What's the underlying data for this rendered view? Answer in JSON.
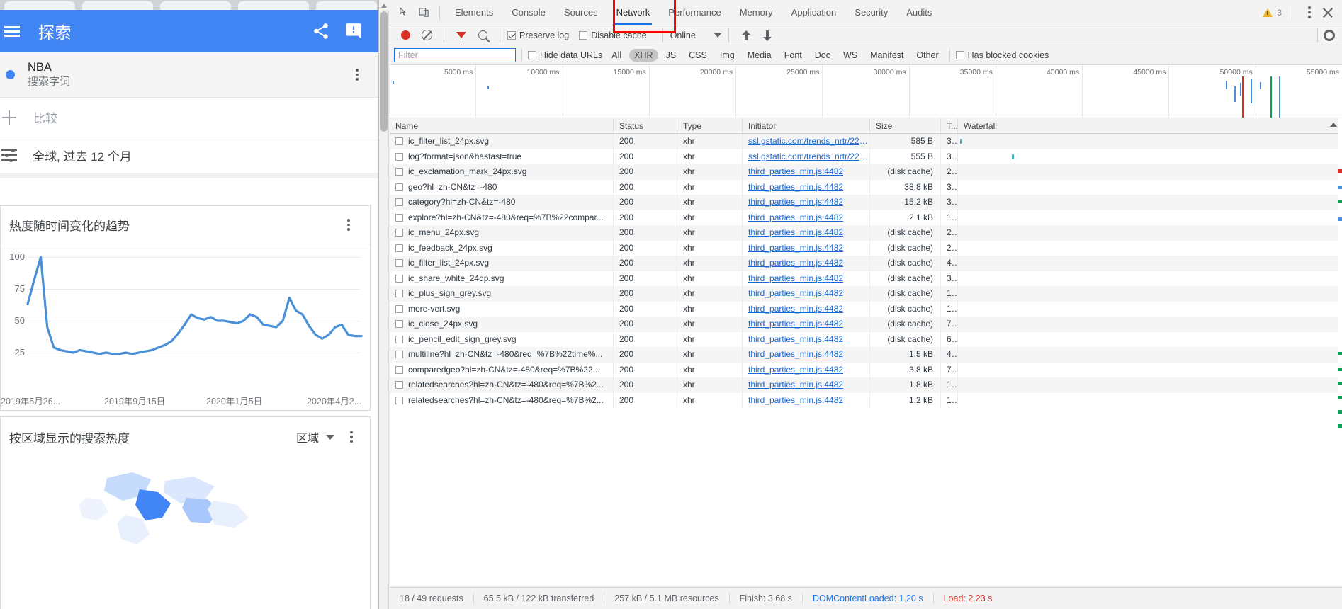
{
  "trends": {
    "app_title": "探索",
    "menu_icon": "hamburger-icon",
    "share_icon": "share-icon",
    "feedback_icon": "feedback-icon",
    "term": {
      "name": "NBA",
      "subtitle": "搜索字词"
    },
    "compare_label": "比较",
    "scope_label": "全球, 过去 12 个月",
    "trend_card": {
      "title": "热度随时间变化的趋势"
    },
    "region_card": {
      "title": "按区域显示的搜索热度",
      "select_value": "区域"
    }
  },
  "chart_data": {
    "type": "line",
    "title": "热度随时间变化的趋势",
    "xlabel": "",
    "ylabel": "",
    "ylim": [
      0,
      100
    ],
    "yticks": [
      100,
      75,
      50,
      25
    ],
    "grid": true,
    "legend": "none",
    "line_color": "#4a90d9",
    "xtick_labels": [
      "2019年5月26...",
      "2019年9月15日",
      "2020年1月5日",
      "2020年4月2..."
    ],
    "x": [
      0,
      1,
      2,
      3,
      4,
      5,
      6,
      7,
      8,
      9,
      10,
      11,
      12,
      13,
      14,
      15,
      16,
      17,
      18,
      19,
      20,
      21,
      22,
      23,
      24,
      25,
      26,
      27,
      28,
      29,
      30,
      31,
      32,
      33,
      34,
      35,
      36,
      37,
      38,
      39,
      40,
      41,
      42,
      43,
      44,
      45,
      46,
      47,
      48,
      49,
      50,
      51
    ],
    "values": [
      63,
      82,
      100,
      45,
      29,
      27,
      26,
      25,
      27,
      26,
      25,
      24,
      25,
      24,
      24,
      25,
      24,
      25,
      26,
      27,
      29,
      31,
      34,
      40,
      47,
      55,
      52,
      51,
      53,
      50,
      50,
      49,
      48,
      50,
      55,
      53,
      47,
      46,
      45,
      50,
      68,
      58,
      55,
      46,
      39,
      36,
      39,
      45,
      47,
      39,
      38,
      38
    ]
  },
  "devtools": {
    "tools": {
      "inspect_icon": "cursor-inspect-icon",
      "device_icon": "device-toolbar-icon"
    },
    "tabs": [
      {
        "label": "Elements",
        "active": false
      },
      {
        "label": "Console",
        "active": false
      },
      {
        "label": "Sources",
        "active": false
      },
      {
        "label": "Network",
        "active": true
      },
      {
        "label": "Performance",
        "active": false
      },
      {
        "label": "Memory",
        "active": false
      },
      {
        "label": "Application",
        "active": false
      },
      {
        "label": "Security",
        "active": false
      },
      {
        "label": "Audits",
        "active": false
      }
    ],
    "warning_count": "3",
    "more_icon": "more-vertical-icon",
    "close_icon": "close-icon",
    "toolbar": {
      "record_icon": "record-stop-icon",
      "clear_icon": "clear-icon",
      "filter_icon": "filter-icon",
      "search_icon": "search-icon",
      "preserve_log": "Preserve log",
      "preserve_log_checked": true,
      "disable_cache": "Disable cache",
      "disable_cache_checked": false,
      "throttle_value": "Online",
      "import_icon": "import-har-icon",
      "export_icon": "export-har-icon",
      "settings_icon": "gear-icon"
    },
    "filterbar": {
      "filter_placeholder": "Filter",
      "filter_value": "",
      "hide_data_urls": "Hide data URLs",
      "hide_data_urls_checked": false,
      "types": [
        "All",
        "XHR",
        "JS",
        "CSS",
        "Img",
        "Media",
        "Font",
        "Doc",
        "WS",
        "Manifest",
        "Other"
      ],
      "active_type": "XHR",
      "has_blocked_cookies": "Has blocked cookies",
      "has_blocked_cookies_checked": false
    },
    "overview_labels": [
      "5000 ms",
      "10000 ms",
      "15000 ms",
      "20000 ms",
      "25000 ms",
      "30000 ms",
      "35000 ms",
      "40000 ms",
      "45000 ms",
      "50000 ms",
      "55000 ms"
    ],
    "columns": [
      "Name",
      "Status",
      "Type",
      "Initiator",
      "Size",
      "T...",
      "Waterfall"
    ],
    "rows": [
      {
        "name": "ic_filter_list_24px.svg",
        "status": "200",
        "type": "xhr",
        "initiator": "ssl.gstatic.com/trends_nrtr/221...",
        "size": "585 B",
        "time": "3...",
        "wf_left": 0.5,
        "wf_width": 0.6
      },
      {
        "name": "log?format=json&hasfast=true",
        "status": "200",
        "type": "xhr",
        "initiator": "ssl.gstatic.com/trends_nrtr/221...",
        "size": "555 B",
        "time": "3...",
        "wf_left": 14,
        "wf_width": 0.6
      },
      {
        "name": "ic_exclamation_mark_24px.svg",
        "status": "200",
        "type": "xhr",
        "initiator": "third_parties_min.js:4482",
        "size": "(disk cache)",
        "time": "2...",
        "wf_left": 0,
        "wf_width": 0
      },
      {
        "name": "geo?hl=zh-CN&tz=-480",
        "status": "200",
        "type": "xhr",
        "initiator": "third_parties_min.js:4482",
        "size": "38.8 kB",
        "time": "3...",
        "wf_left": 0,
        "wf_width": 0
      },
      {
        "name": "category?hl=zh-CN&tz=-480",
        "status": "200",
        "type": "xhr",
        "initiator": "third_parties_min.js:4482",
        "size": "15.2 kB",
        "time": "3...",
        "wf_left": 0,
        "wf_width": 0
      },
      {
        "name": "explore?hl=zh-CN&tz=-480&req=%7B%22compar...",
        "status": "200",
        "type": "xhr",
        "initiator": "third_parties_min.js:4482",
        "size": "2.1 kB",
        "time": "1...",
        "wf_left": 0,
        "wf_width": 0
      },
      {
        "name": "ic_menu_24px.svg",
        "status": "200",
        "type": "xhr",
        "initiator": "third_parties_min.js:4482",
        "size": "(disk cache)",
        "time": "2...",
        "wf_left": 0,
        "wf_width": 0
      },
      {
        "name": "ic_feedback_24px.svg",
        "status": "200",
        "type": "xhr",
        "initiator": "third_parties_min.js:4482",
        "size": "(disk cache)",
        "time": "2...",
        "wf_left": 0,
        "wf_width": 0
      },
      {
        "name": "ic_filter_list_24px.svg",
        "status": "200",
        "type": "xhr",
        "initiator": "third_parties_min.js:4482",
        "size": "(disk cache)",
        "time": "4...",
        "wf_left": 0,
        "wf_width": 0
      },
      {
        "name": "ic_share_white_24dp.svg",
        "status": "200",
        "type": "xhr",
        "initiator": "third_parties_min.js:4482",
        "size": "(disk cache)",
        "time": "3...",
        "wf_left": 0,
        "wf_width": 0
      },
      {
        "name": "ic_plus_sign_grey.svg",
        "status": "200",
        "type": "xhr",
        "initiator": "third_parties_min.js:4482",
        "size": "(disk cache)",
        "time": "1...",
        "wf_left": 0,
        "wf_width": 0
      },
      {
        "name": "more-vert.svg",
        "status": "200",
        "type": "xhr",
        "initiator": "third_parties_min.js:4482",
        "size": "(disk cache)",
        "time": "1...",
        "wf_left": 0,
        "wf_width": 0
      },
      {
        "name": "ic_close_24px.svg",
        "status": "200",
        "type": "xhr",
        "initiator": "third_parties_min.js:4482",
        "size": "(disk cache)",
        "time": "7...",
        "wf_left": 0,
        "wf_width": 0
      },
      {
        "name": "ic_pencil_edit_sign_grey.svg",
        "status": "200",
        "type": "xhr",
        "initiator": "third_parties_min.js:4482",
        "size": "(disk cache)",
        "time": "6...",
        "wf_left": 0,
        "wf_width": 0
      },
      {
        "name": "multiline?hl=zh-CN&tz=-480&req=%7B%22time%...",
        "status": "200",
        "type": "xhr",
        "initiator": "third_parties_min.js:4482",
        "size": "1.5 kB",
        "time": "4...",
        "wf_left": 0,
        "wf_width": 0
      },
      {
        "name": "comparedgeo?hl=zh-CN&tz=-480&req=%7B%22...",
        "status": "200",
        "type": "xhr",
        "initiator": "third_parties_min.js:4482",
        "size": "3.8 kB",
        "time": "7...",
        "wf_left": 0,
        "wf_width": 0
      },
      {
        "name": "relatedsearches?hl=zh-CN&tz=-480&req=%7B%2...",
        "status": "200",
        "type": "xhr",
        "initiator": "third_parties_min.js:4482",
        "size": "1.8 kB",
        "time": "1...",
        "wf_left": 0,
        "wf_width": 0
      },
      {
        "name": "relatedsearches?hl=zh-CN&tz=-480&req=%7B%2...",
        "status": "200",
        "type": "xhr",
        "initiator": "third_parties_min.js:4482",
        "size": "1.2 kB",
        "time": "1...",
        "wf_left": 0,
        "wf_width": 0
      }
    ],
    "status_bar": {
      "requests": "18 / 49 requests",
      "transferred": "65.5 kB / 122 kB transferred",
      "resources": "257 kB / 5.1 MB resources",
      "finish": "Finish: 3.68 s",
      "dom_content_loaded": "DOMContentLoaded: 1.20 s",
      "load": "Load: 2.23 s"
    }
  },
  "annotation": {
    "color": "#ff0000",
    "target": "Network"
  }
}
